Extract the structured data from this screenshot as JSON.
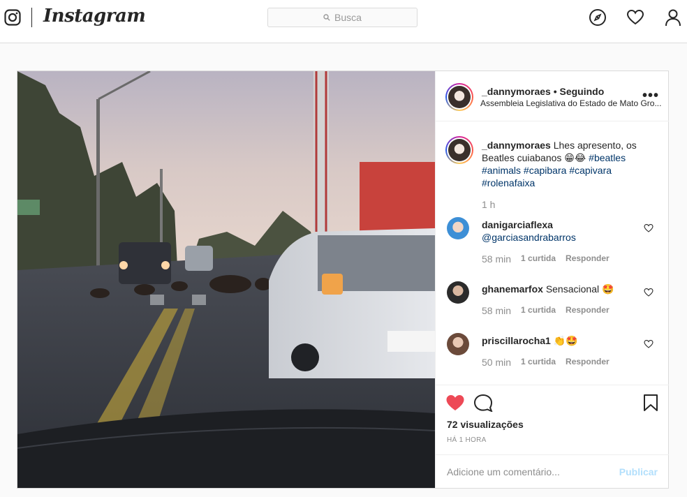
{
  "app": {
    "name": "Instagram",
    "search_placeholder": "Busca"
  },
  "post": {
    "username": "_dannymoraes",
    "follow_status": "Seguindo",
    "header_text": "_dannymoraes • Seguindo",
    "location": "Assembleia Legislativa do Estado de Mato Gro...",
    "caption": {
      "username": "_dannymoraes",
      "text": " Lhes apresento, os Beatles cuiabanos 😁😂 ",
      "hashtags": [
        "#beatles",
        "#animals",
        "#capibara",
        "#capivara",
        "#rolenafaixa"
      ]
    },
    "caption_time": "1 h",
    "comments": [
      {
        "username": "danigarciaflexa",
        "text": "@garciasandrabarros",
        "time": "58 min",
        "likes": "1 curtida",
        "reply": "Responder"
      },
      {
        "username": "ghanemarfox",
        "text": "Sensacional 🤩",
        "time": "58 min",
        "likes": "1 curtida",
        "reply": "Responder"
      },
      {
        "username": "priscillarocha1",
        "text": "👏🤩",
        "time": "50 min",
        "likes": "1 curtida",
        "reply": "Responder"
      }
    ],
    "views": "72 visualizações",
    "posted_ago": "HÁ 1 HORA",
    "add_comment_placeholder": "Adicione um comentário...",
    "publish_label": "Publicar"
  },
  "icons": {
    "logo": "instagram-glyph-icon",
    "explore": "compass-icon",
    "activity": "heart-outline-icon",
    "profile": "user-icon",
    "search": "search-icon",
    "liked": "heart-filled-icon",
    "comment": "speech-bubble-icon",
    "save": "bookmark-icon",
    "more": "more-options-icon"
  },
  "colors": {
    "like_red": "#ed4956",
    "hashtag": "#003569",
    "publish_disabled": "#b2dffc",
    "muted": "#8e8e8e"
  }
}
